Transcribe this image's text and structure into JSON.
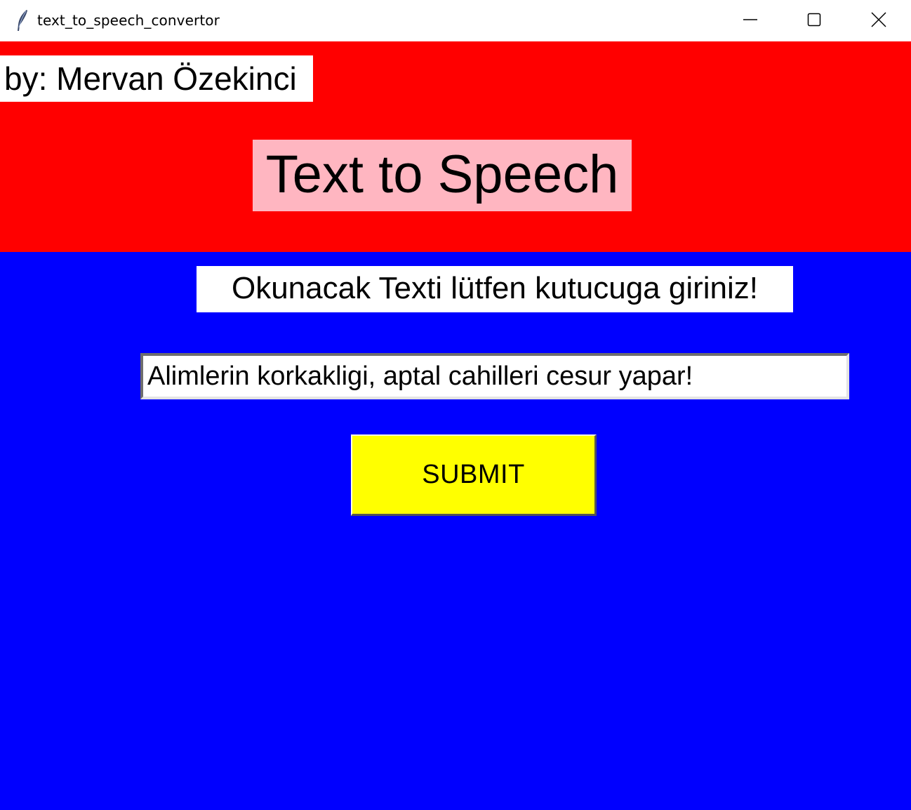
{
  "window": {
    "title": "text_to_speech_convertor",
    "app_icon": "feather-icon",
    "controls": {
      "minimize_icon": "minimize-icon",
      "maximize_icon": "maximize-icon",
      "close_icon": "close-icon"
    }
  },
  "header": {
    "byline": "by: Mervan Özekinci",
    "title": "Text to Speech",
    "background_color": "#ff0000",
    "title_background_color": "#ffb6c1"
  },
  "main": {
    "prompt_label": "Okunacak Texti lütfen kutucuga giriniz!",
    "text_input": {
      "value": "Alimlerin korkakligi, aptal cahilleri cesur yapar!"
    },
    "submit_label": "SUBMIT",
    "background_color": "#0000ff",
    "submit_color": "#ffff00"
  }
}
